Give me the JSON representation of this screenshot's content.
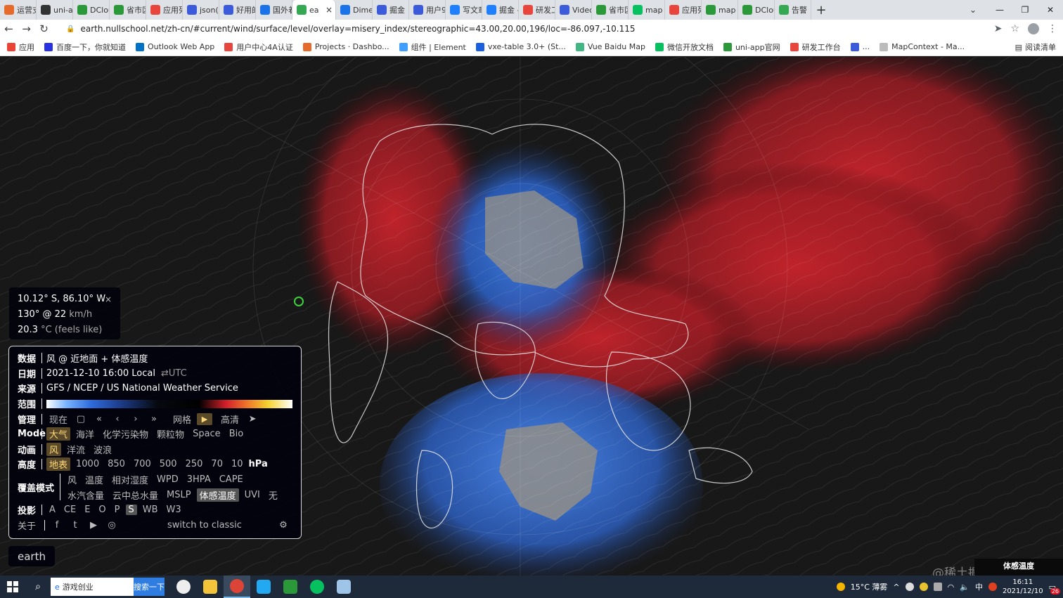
{
  "browser": {
    "tabs": [
      {
        "label": "运营支",
        "color": "#e66a2c"
      },
      {
        "label": "uni-a",
        "color": "#333333"
      },
      {
        "label": "DClou",
        "color": "#2b9939"
      },
      {
        "label": "省市区",
        "color": "#2b9939"
      },
      {
        "label": "应用列",
        "color": "#e8453c"
      },
      {
        "label": "json(",
        "color": "#3b5bdb"
      },
      {
        "label": "好用的",
        "color": "#3b5bdb"
      },
      {
        "label": "国外着",
        "color": "#1a73e8"
      },
      {
        "label": "ea",
        "color": "#34a853",
        "active": true
      },
      {
        "label": "Dime",
        "color": "#1a73e8"
      },
      {
        "label": "掘金",
        "color": "#3b5bdb"
      },
      {
        "label": "用户9",
        "color": "#3b5bdb"
      },
      {
        "label": "写文章",
        "color": "#1e80ff"
      },
      {
        "label": "掘金 -",
        "color": "#1e80ff"
      },
      {
        "label": "研发工",
        "color": "#e8453c"
      },
      {
        "label": "Video",
        "color": "#3b5bdb"
      },
      {
        "label": "省市区",
        "color": "#2b9939"
      },
      {
        "label": "map",
        "color": "#07c160"
      },
      {
        "label": "应用列",
        "color": "#e8453c"
      },
      {
        "label": "map",
        "color": "#2b9939"
      },
      {
        "label": "DClou",
        "color": "#2b9939"
      },
      {
        "label": "告警",
        "color": "#34a853"
      }
    ],
    "new_tab": "+",
    "tab_search": "⌄",
    "window_controls": {
      "minimize": "—",
      "restore": "❐",
      "close": "✕"
    },
    "nav": {
      "back": "←",
      "forward": "→",
      "reload": "↻"
    },
    "url": "earth.nullschool.net/zh-cn/#current/wind/surface/level/overlay=misery_index/stereographic=43.00,20.00,196/loc=-86.097,-10.115",
    "bookmarks": [
      {
        "label": "应用",
        "color": "#ea4335"
      },
      {
        "label": "百度一下，你就知道",
        "color": "#2932e1"
      },
      {
        "label": "Outlook Web App",
        "color": "#0072c6"
      },
      {
        "label": "用户中心4A认证",
        "color": "#e8453c"
      },
      {
        "label": "Projects · Dashbo...",
        "color": "#e66a2c"
      },
      {
        "label": "组件 | Element",
        "color": "#409eff"
      },
      {
        "label": "vxe-table 3.0+ (St...",
        "color": "#1a5fe0"
      },
      {
        "label": "Vue Baidu Map",
        "color": "#41b883"
      },
      {
        "label": "微信开放文档",
        "color": "#07c160"
      },
      {
        "label": "uni-app官网",
        "color": "#2b9939"
      },
      {
        "label": "研发工作台",
        "color": "#e8453c"
      },
      {
        "label": "...",
        "color": "#3b5bdb"
      },
      {
        "label": "MapContext - Ma...",
        "color": "#bbbbbb"
      }
    ],
    "reading_list": "阅读清单"
  },
  "location": {
    "coords": "10.12° S, 86.10° W",
    "wind": "130° @ 22",
    "wind_unit": "km/h",
    "temp": "20.3",
    "temp_unit": "°C (feels like)",
    "close": "×"
  },
  "menu": {
    "data": {
      "label": "数据",
      "value": "风 @ 近地面 + 体感温度"
    },
    "date": {
      "label": "日期",
      "value": "2021-12-10 16:00 Local",
      "toggle": "⇄UTC"
    },
    "source": {
      "label": "来源",
      "value": "GFS / NCEP / US National Weather Service"
    },
    "scale": {
      "label": "范围"
    },
    "control": {
      "label": "管理",
      "now": "现在",
      "calendar": "▢",
      "ff_back": "«",
      "back": "‹",
      "fwd": "›",
      "ff_fwd": "»",
      "grid": "网格",
      "play": "▶",
      "hd": "高清",
      "locate": "➤"
    },
    "mode": {
      "label": "Mode",
      "options": [
        "大气",
        "海洋",
        "化学污染物",
        "颗粒物",
        "Space",
        "Bio"
      ]
    },
    "animate": {
      "label": "动画",
      "options": [
        "风",
        "洋流",
        "波浪"
      ]
    },
    "height": {
      "label": "高度",
      "options": [
        "地表",
        "1000",
        "850",
        "700",
        "500",
        "250",
        "70",
        "10"
      ],
      "unit": "hPa"
    },
    "overlay": {
      "label": "覆盖模式",
      "row1": [
        "风",
        "温度",
        "相对湿度",
        "WPD",
        "3HPA",
        "CAPE"
      ],
      "row2": [
        "水汽含量",
        "云中总水量",
        "MSLP",
        "体感温度",
        "UVI",
        "无"
      ]
    },
    "projection": {
      "label": "投影",
      "options": [
        "A",
        "CE",
        "E",
        "O",
        "P",
        "S",
        "WB",
        "W3"
      ]
    },
    "about": {
      "label": "关于",
      "classic": "switch to classic",
      "settings": "⚙"
    }
  },
  "earth_button": "earth",
  "legend_tag": "体感温度",
  "watermark": "@稀土掘金技术社区",
  "taskbar": {
    "search_text": "游戏创业",
    "search_btn": "搜索一下",
    "weather": "15°C  薄雾",
    "time": "16:11",
    "date": "2021/12/10",
    "ime": "中",
    "notif": "26"
  }
}
